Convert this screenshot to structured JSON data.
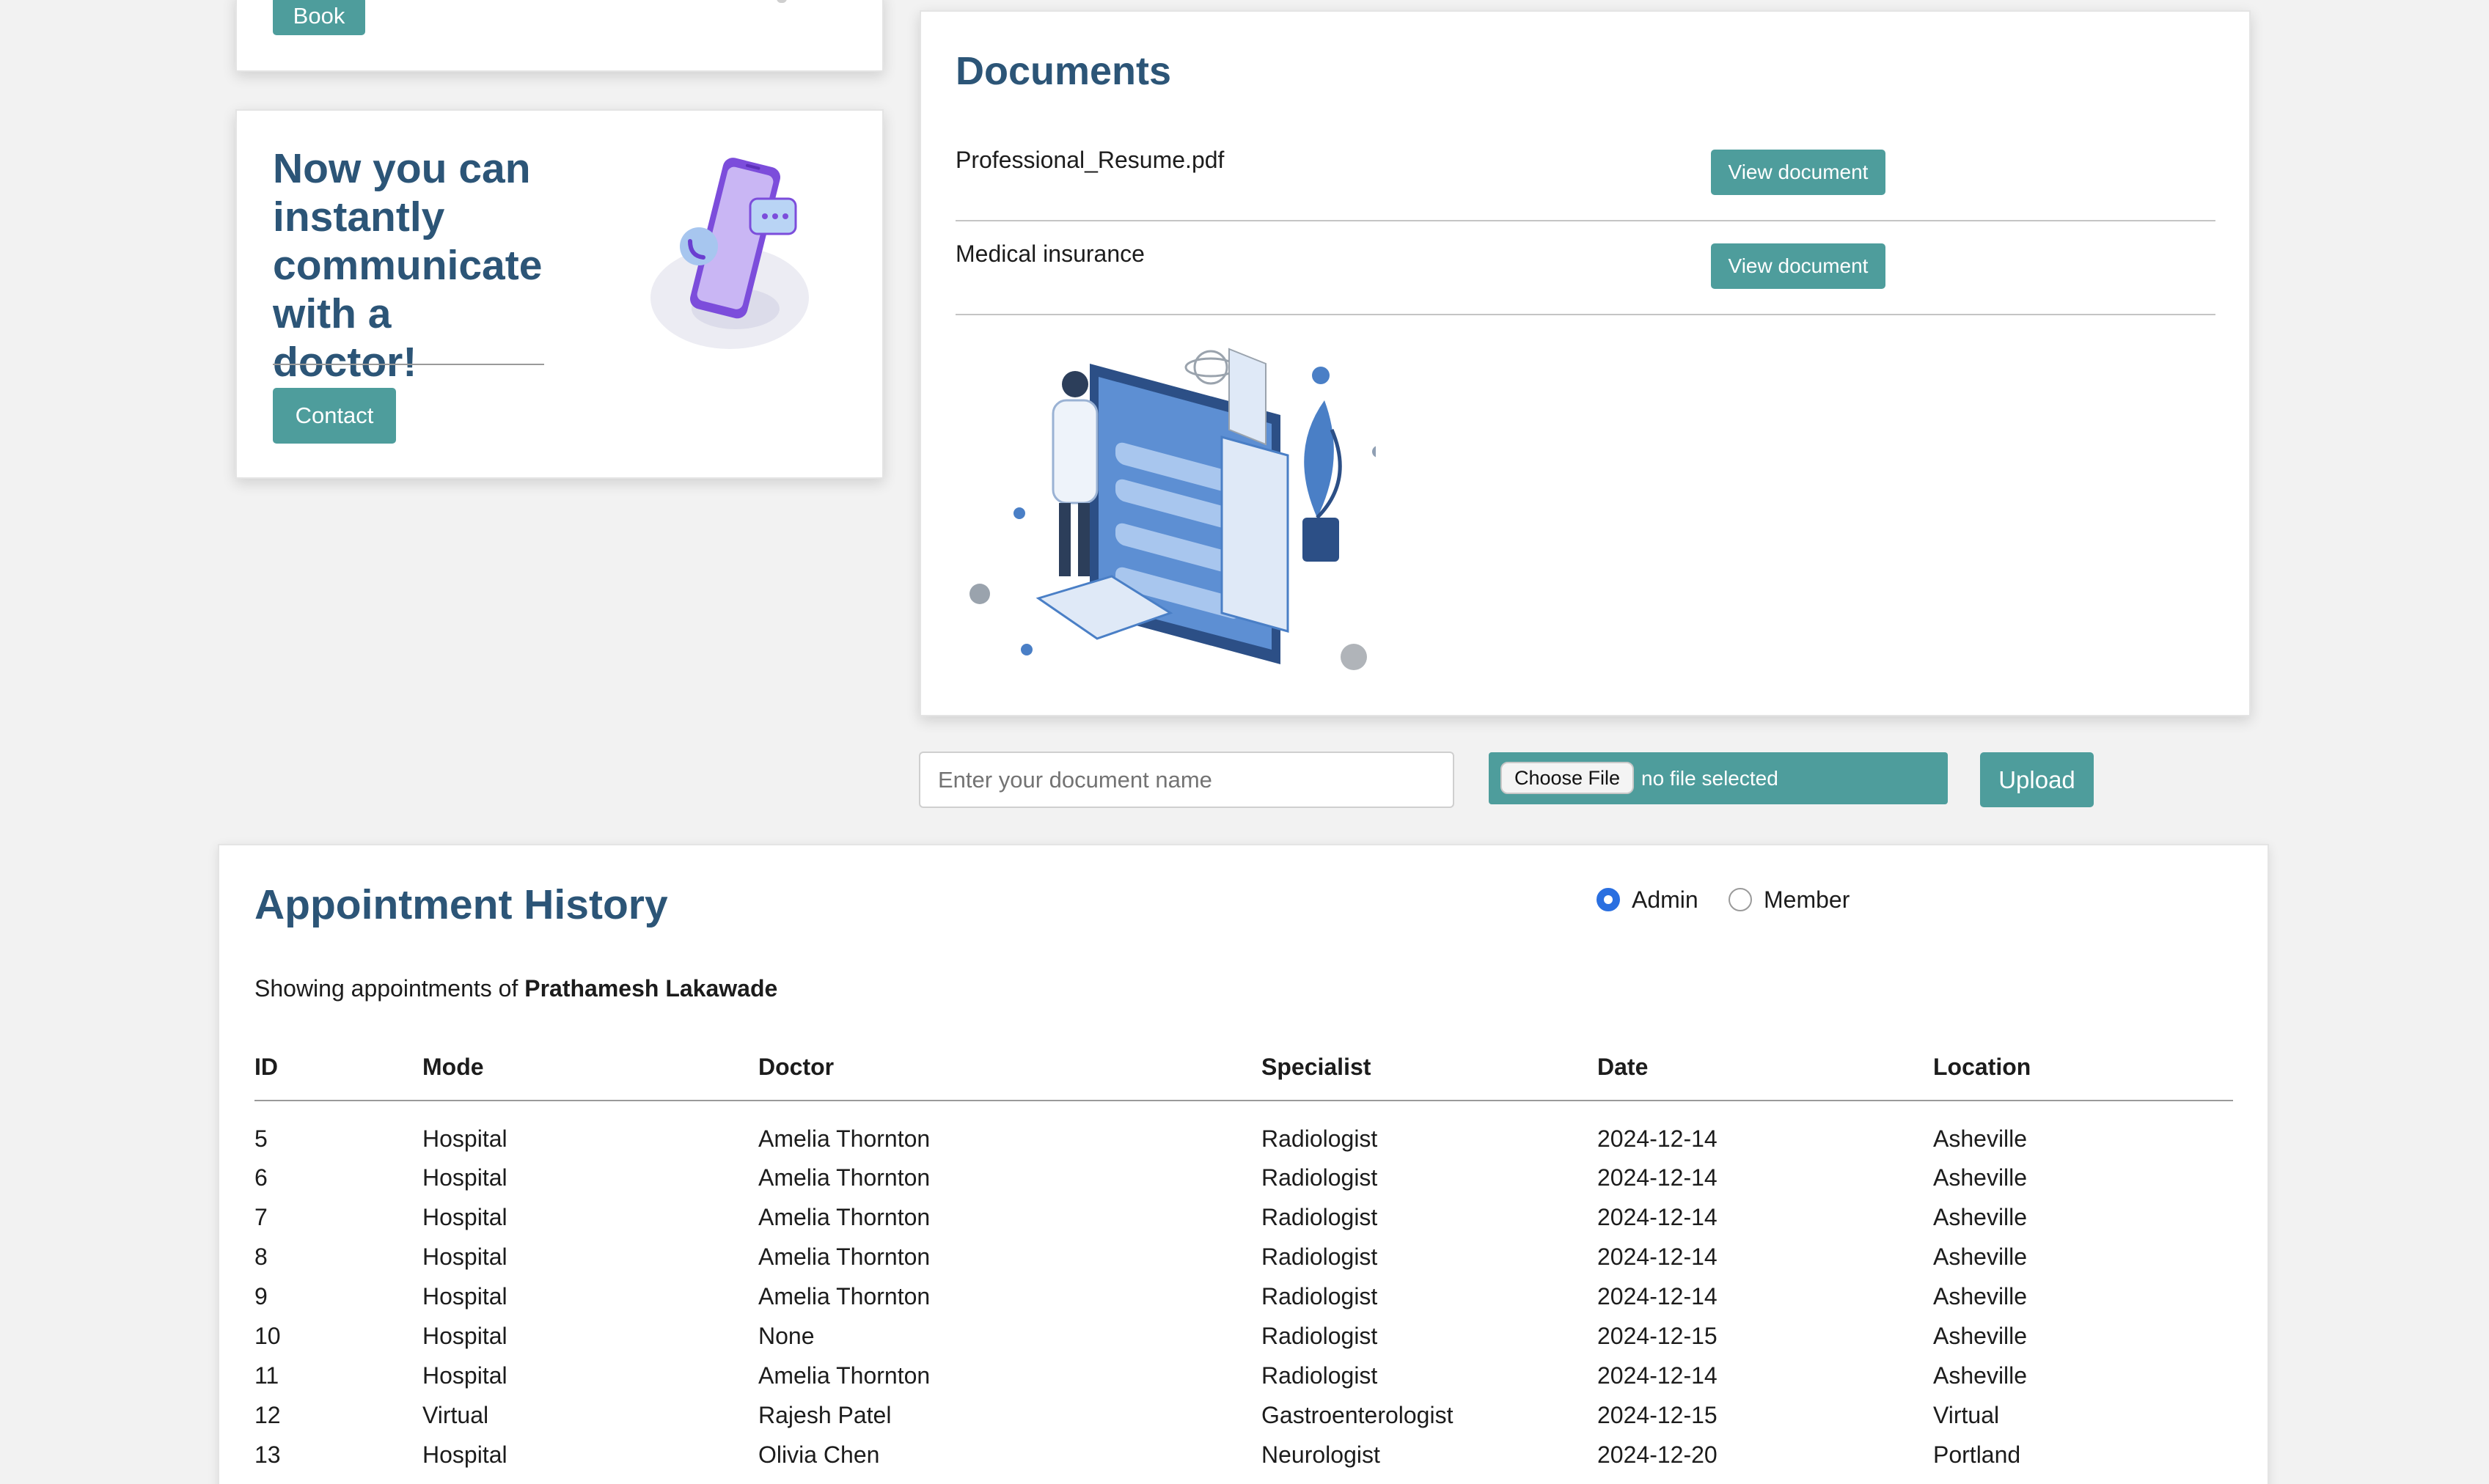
{
  "book_card": {
    "book_label": "Book"
  },
  "contact_card": {
    "title": "Now you can instantly communicate with a doctor!",
    "contact_label": "Contact"
  },
  "documents": {
    "title": "Documents",
    "items": [
      {
        "name": "Professional_Resume.pdf",
        "action": "View document"
      },
      {
        "name": "Medical insurance",
        "action": "View document"
      }
    ]
  },
  "upload": {
    "name_placeholder": "Enter your document name",
    "choose_file_label": "Choose File",
    "file_status": "no file selected",
    "upload_label": "Upload"
  },
  "appointments": {
    "title": "Appointment History",
    "role_options": [
      {
        "label": "Admin",
        "selected": true
      },
      {
        "label": "Member",
        "selected": false
      }
    ],
    "showing_prefix": "Showing appointments of",
    "user_name": "Prathamesh Lakawade",
    "columns": [
      "ID",
      "Mode",
      "Doctor",
      "Specialist",
      "Date",
      "Location"
    ],
    "rows": [
      [
        "5",
        "Hospital",
        "Amelia Thornton",
        "Radiologist",
        "2024-12-14",
        "Asheville"
      ],
      [
        "6",
        "Hospital",
        "Amelia Thornton",
        "Radiologist",
        "2024-12-14",
        "Asheville"
      ],
      [
        "7",
        "Hospital",
        "Amelia Thornton",
        "Radiologist",
        "2024-12-14",
        "Asheville"
      ],
      [
        "8",
        "Hospital",
        "Amelia Thornton",
        "Radiologist",
        "2024-12-14",
        "Asheville"
      ],
      [
        "9",
        "Hospital",
        "Amelia Thornton",
        "Radiologist",
        "2024-12-14",
        "Asheville"
      ],
      [
        "10",
        "Hospital",
        "None",
        "Radiologist",
        "2024-12-15",
        "Asheville"
      ],
      [
        "11",
        "Hospital",
        "Amelia Thornton",
        "Radiologist",
        "2024-12-14",
        "Asheville"
      ],
      [
        "12",
        "Virtual",
        "Rajesh Patel",
        "Gastroenterologist",
        "2024-12-15",
        "Virtual"
      ],
      [
        "13",
        "Hospital",
        "Olivia Chen",
        "Neurologist",
        "2024-12-20",
        "Portland"
      ]
    ]
  },
  "colors": {
    "accent": "#4e9d9c",
    "heading": "#2c5577",
    "radio_selected": "#2a6fe0"
  }
}
